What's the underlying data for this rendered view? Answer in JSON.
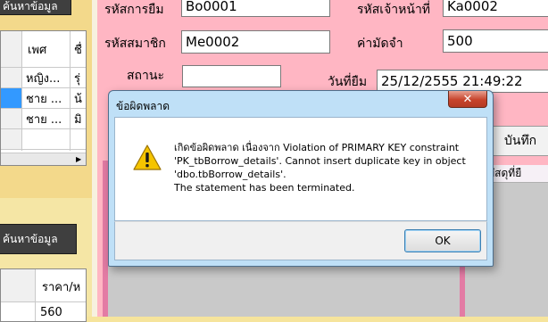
{
  "left_panel": {
    "search_button_top": "ค้นหาข้อมูล",
    "member_grid": {
      "headers": [
        "เพศ",
        "ชื่"
      ],
      "rows": [
        {
          "gender": "หญิง...",
          "extra": "รุ่"
        },
        {
          "gender": "ชาย ...",
          "extra": "น้"
        },
        {
          "gender": "ชาย ...",
          "extra": "มิ"
        }
      ]
    },
    "search_button_bottom": "ค้นหาข้อมูล",
    "book_grid": {
      "header": "ราคา/ห",
      "first_value": "560"
    }
  },
  "form": {
    "borrow_id_label": "รหัสการยืม",
    "borrow_id_value": "Bo0001",
    "staff_id_label": "รหัสเจ้าหน้าที่",
    "staff_id_value": "Ka0002",
    "member_id_label": "รหัสสมาชิก",
    "member_id_value": "Me0002",
    "deposit_label": "ค่ามัดจำ",
    "deposit_value": "500",
    "status_label": "สถานะ",
    "status_value": "",
    "borrow_date_label": "วันที่ยืม",
    "borrow_date_value": "25/12/2555 21:49:22",
    "save_button": "บันทึก",
    "grid_header_partial": "มูลพัสดุที่ยื"
  },
  "dialog": {
    "title": "ข้อผิดพลาด",
    "close_glyph": "✕",
    "message_lines": [
      "เกิดข้อผิดพลาด เนื่องจาก Violation of PRIMARY KEY constraint",
      "'PK_tbBorrow_details'. Cannot insert duplicate key in object",
      "'dbo.tbBorrow_details'.",
      "The statement has been terminated."
    ],
    "ok_label": "OK",
    "icon": "warning-icon"
  },
  "colors": {
    "form_background": "#ffb6c3",
    "panel_background": "#f6e49c",
    "dialog_frame": "#bfe0f7",
    "selected_row": "#3399ff"
  }
}
